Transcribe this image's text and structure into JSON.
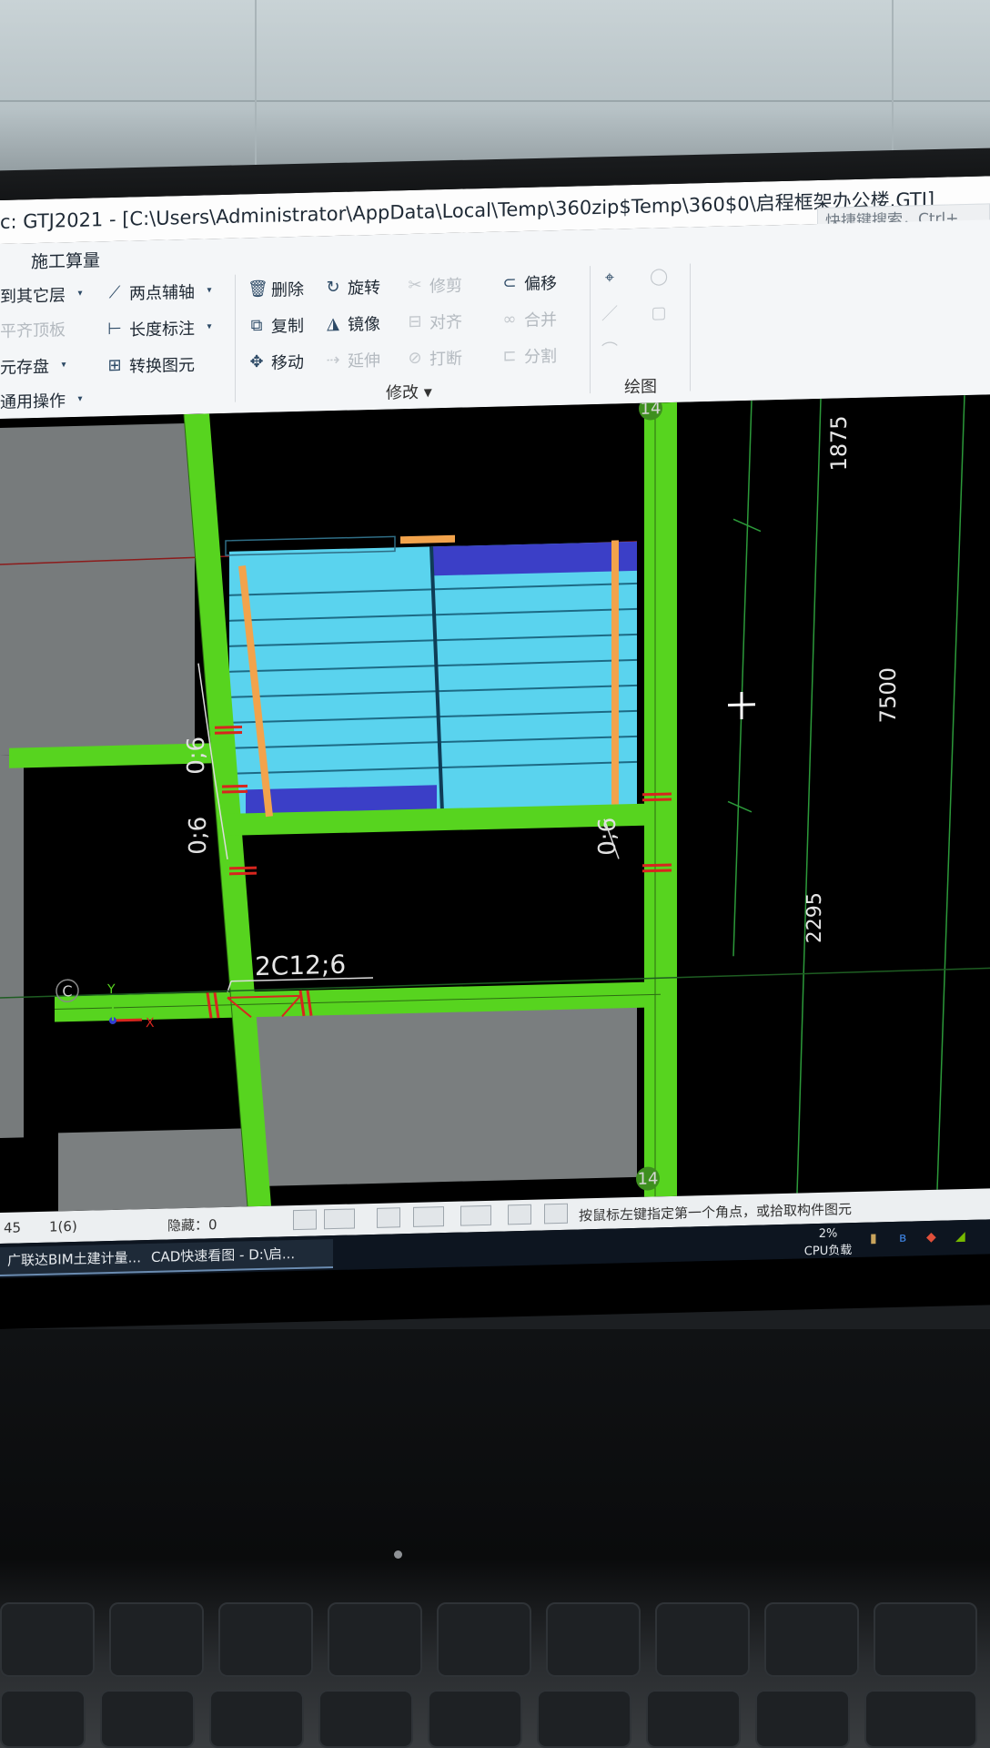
{
  "window": {
    "title": "с: GTJ2021 - [C:\\Users\\Administrator\\AppData\\Local\\Temp\\360zip$Temp\\360$0\\启程框架办公楼.GTJ]",
    "quick_search_placeholder": "快捷键搜索，Ctrl+"
  },
  "ribbon": {
    "tab": "施工算量",
    "left_items": [
      {
        "label": "到其它层",
        "icon": "copy-layer-icon"
      },
      {
        "label": "平齐顶板",
        "icon": "align-top-icon"
      },
      {
        "label": "元存盘",
        "icon": "save-icon"
      },
      {
        "label": "通用操作",
        "icon": "general-icon"
      }
    ],
    "aux": {
      "two_point_axis": "两点辅轴",
      "length_dim": "长度标注",
      "convert": "转换图元"
    },
    "modify": {
      "delete": "删除",
      "copy": "复制",
      "move": "移动",
      "rotate": "旋转",
      "mirror": "镜像",
      "extend": "延伸",
      "trim": "修剪",
      "align": "对齐",
      "break": "打断",
      "offset": "偏移",
      "merge": "合并",
      "split": "分割",
      "group_label": "修改"
    },
    "draw": {
      "group_label": "绘图"
    }
  },
  "cad": {
    "axis_top": "14",
    "axis_bottom": "14",
    "axis_left": "C",
    "dim_top": "1875",
    "dim_mid": "7500",
    "dim_bottom": "2295",
    "rebar_1": "0;6",
    "rebar_2": "0;6",
    "rebar_3": "0;6",
    "rebar_main": "2C12;6",
    "ucs_y": "Y",
    "ucs_x": "X",
    "colors": {
      "beam": "#57d41f",
      "slab_gray": "#777b7c",
      "stair_fill": "#5ad3ee",
      "stair_dark": "#3b3fc7",
      "rebar_orange": "#f2a34c",
      "background": "#000000"
    }
  },
  "statusbar": {
    "coord": "45",
    "layer": "1(6)",
    "hidden": "隐藏：0",
    "prompt": "按鼠标左键指定第一个角点，或拾取构件图元"
  },
  "taskbar": {
    "app1": "广联达BIM土建计量...",
    "app2": "CAD快速看图 - D:\\启...",
    "cpu_percent": "2%",
    "cpu_label": "CPU负载"
  }
}
